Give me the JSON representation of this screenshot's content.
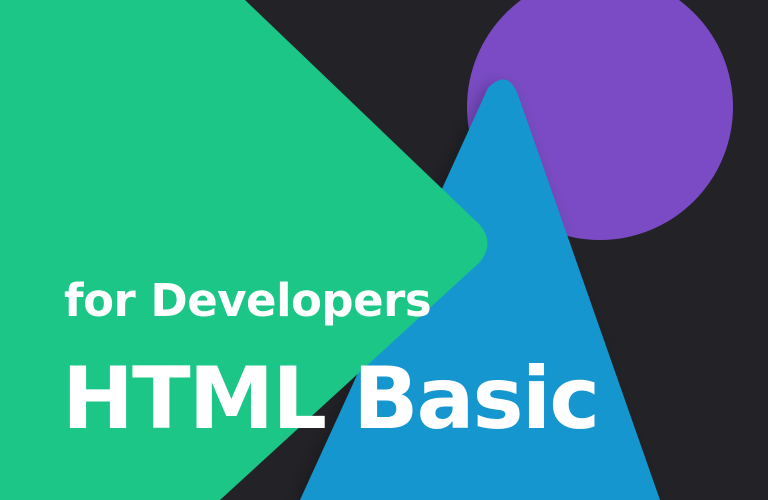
{
  "cover": {
    "subtitle": "for Developers",
    "title": "HTML Basic"
  },
  "colors": {
    "background": "#232227",
    "green_shape": "#1bc686",
    "blue_shape": "#1496ce",
    "purple_circle": "#7a4bc4",
    "text": "#ffffff"
  },
  "shapes": [
    "purple-circle",
    "blue-triangle",
    "green-triangle"
  ]
}
